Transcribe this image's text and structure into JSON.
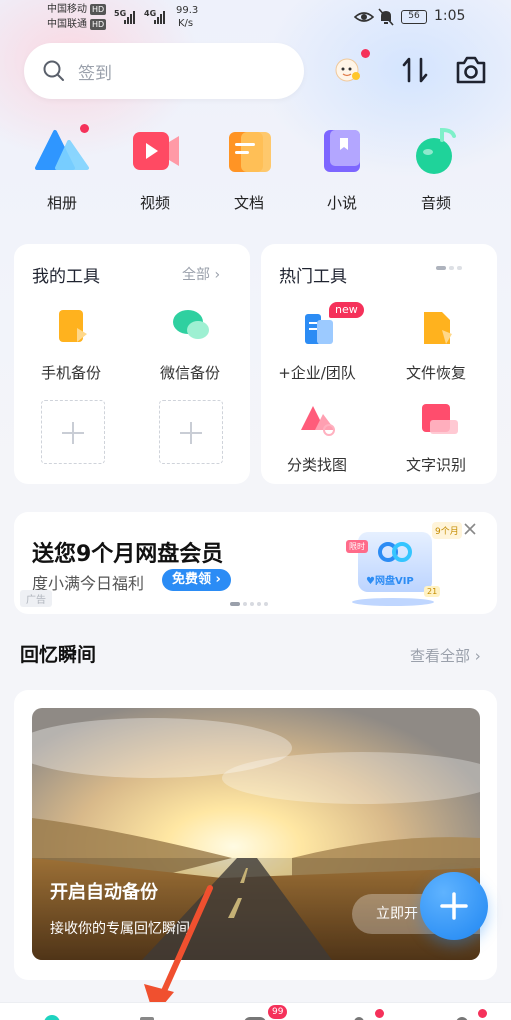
{
  "status_bar": {
    "carrier1": "中国移动",
    "carrier2": "中国联通",
    "hd": "HD",
    "net1": "5G",
    "net2": "4G",
    "speed_value": "99.3",
    "speed_unit": "K/s",
    "battery": "56",
    "time": "1:05"
  },
  "search": {
    "placeholder": "签到"
  },
  "quick_actions": [
    {
      "label": "相册",
      "icon": "album-icon",
      "color": "#3fa3ff"
    },
    {
      "label": "视频",
      "icon": "video-icon",
      "color": "#ff5a6b"
    },
    {
      "label": "文档",
      "icon": "document-icon",
      "color": "#ff9d2e"
    },
    {
      "label": "小说",
      "icon": "novel-icon",
      "color": "#7a6cff"
    },
    {
      "label": "音频",
      "icon": "audio-icon",
      "color": "#2fd49a"
    }
  ],
  "my_tools": {
    "title": "我的工具",
    "all": "全部",
    "items": [
      "手机备份",
      "微信备份"
    ]
  },
  "hot_tools": {
    "title": "热门工具",
    "badge": "new",
    "items": [
      "+企业/团队",
      "文件恢复",
      "分类找图",
      "文字识别"
    ]
  },
  "ad": {
    "title": "送您9个月网盘会员",
    "subtitle": "度小满今日福利",
    "button": "免费领",
    "tag": "广告",
    "limited": "限时",
    "months": "9个月",
    "vip": "网盘VIP",
    "count": "21"
  },
  "memories": {
    "title": "回忆瞬间",
    "view_all": "查看全部",
    "card_title": "开启自动备份",
    "card_sub": "接收你的专属回忆瞬间",
    "button": "立即开"
  },
  "nav": {
    "badge": "99"
  },
  "colors": {
    "accent": "#2c8cf4",
    "badge": "#f5315a",
    "pill": "#2b8cf5"
  }
}
